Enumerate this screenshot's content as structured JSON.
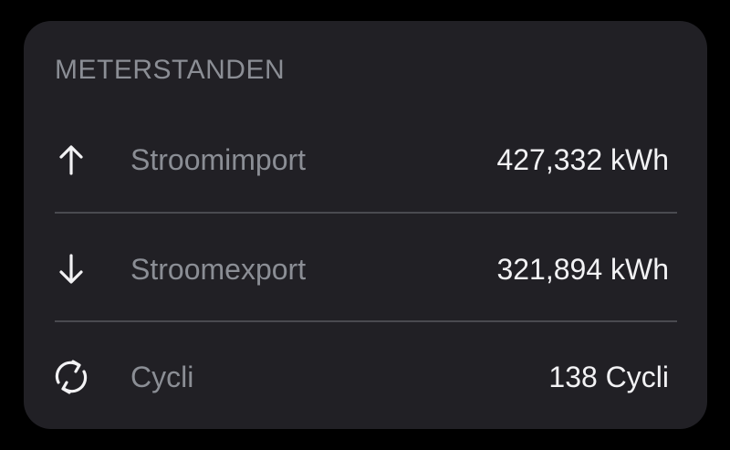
{
  "card": {
    "title": "METERSTANDEN",
    "rows": [
      {
        "icon": "arrow-up-icon",
        "label": "Stroomimport",
        "value": "427,332 kWh"
      },
      {
        "icon": "arrow-down-icon",
        "label": "Stroomexport",
        "value": "321,894 kWh"
      },
      {
        "icon": "cycle-icon",
        "label": "Cycli",
        "value": "138 Cycli"
      }
    ]
  },
  "colors": {
    "page_background": "#000000",
    "card_background": "#212025",
    "title_text": "#8b8e95",
    "label_text": "#8b8e95",
    "value_text": "#f2f2f4",
    "icon": "#f2f2f4",
    "divider": "#4a4a50"
  }
}
